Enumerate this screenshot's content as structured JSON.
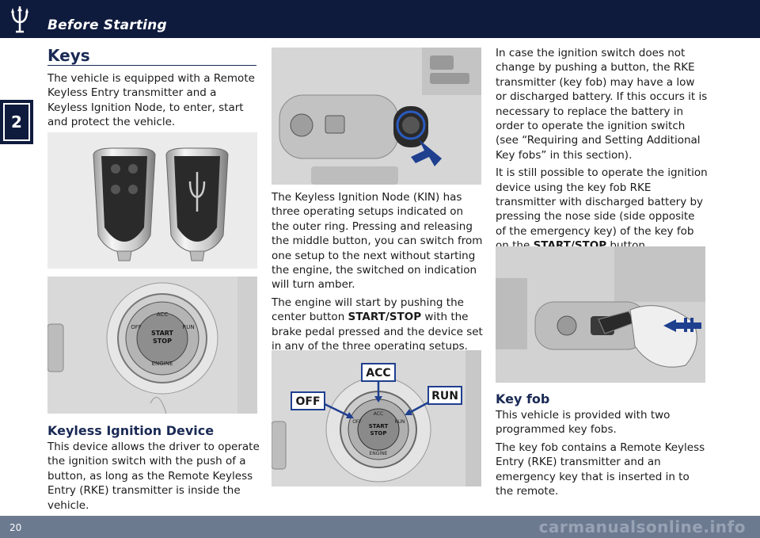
{
  "header": {
    "section_title": "Before Starting",
    "logo_icon": "trident-icon"
  },
  "chapter_tab": {
    "number": "2"
  },
  "footer": {
    "page_number": "20",
    "watermark": "carmanualsonline.info"
  },
  "col1": {
    "heading_keys": "Keys",
    "intro": "The vehicle is equipped with a Remote Keyless Entry transmitter and a Keyless Ignition Node, to enter, start and protect the vehicle.",
    "heading_kid": "Keyless Ignition Device",
    "kid_text": "This device allows the driver to operate the ignition switch with the push of a button, as long as the Remote Keyless Entry (RKE) transmitter is inside the vehicle."
  },
  "col2": {
    "kin_text": "The Keyless Ignition Node (KIN) has three operating setups indicated on the outer ring. Pressing and releasing the middle button, you can switch from one setup to the next without starting the engine, the switched on indication will turn amber.",
    "start_pre": "The engine will start by pushing the center button ",
    "start_bold": "START/STOP",
    "start_post": " with the brake pedal pressed and the device set in any of the three operating setups.",
    "callouts": {
      "off": "OFF",
      "acc": "ACC",
      "run": "RUN"
    }
  },
  "col3": {
    "battery_text": "In case the ignition switch does not change by pushing a button, the RKE transmitter (key fob) may have a low or discharged battery. If this occurs it is necessary to replace the battery in order to operate the ignition switch (see “Requiring and Setting Additional Key fobs” in this section).",
    "possible_pre": "It is still possible to operate the ignition device using the key fob RKE transmitter with discharged battery by pressing the nose side (side opposite of the emergency key) of the key fob on the ",
    "possible_bold": "START/STOP",
    "possible_post": " button.",
    "heading_keyfob": "Key fob",
    "keyfob_text1": "This vehicle is provided with two programmed key fobs.",
    "keyfob_text2": "The key fob contains a Remote Keyless Entry (RKE) transmitter and an emergency key that is inserted in to the remote."
  },
  "knob_labels": {
    "acc": "ACC",
    "run": "RUN",
    "off": "OFF",
    "engine": "ENGINE",
    "start": "START",
    "stop": "STOP"
  },
  "colors": {
    "navy": "#0f1b3d",
    "heading": "#1a2a55",
    "footer": "#6c7a90",
    "arrow_blue": "#1f3f8f"
  }
}
